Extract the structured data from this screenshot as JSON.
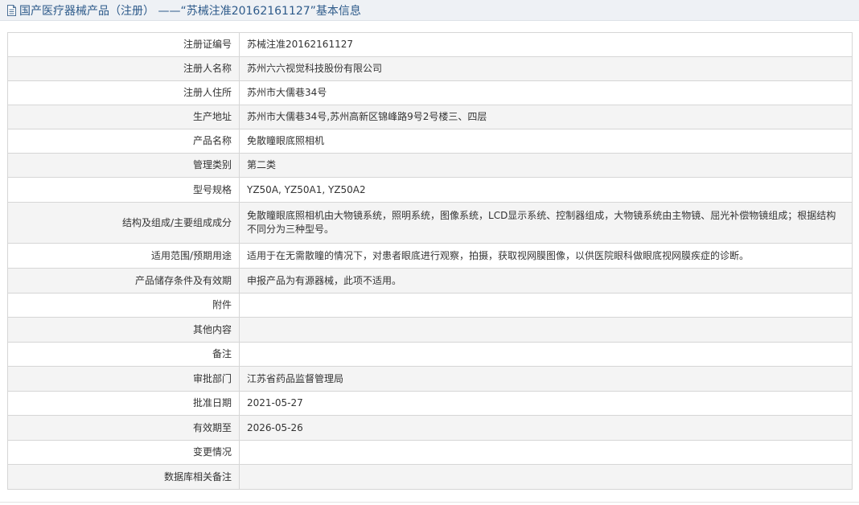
{
  "header": {
    "icon": "document-icon",
    "title": "国产医疗器械产品（注册） ——“苏械注准20162161127”基本信息"
  },
  "rows": [
    {
      "key": "reg_no",
      "label": "注册证编号",
      "value": "苏械注准20162161127"
    },
    {
      "key": "registrant_name",
      "label": "注册人名称",
      "value": "苏州六六视觉科技股份有限公司"
    },
    {
      "key": "registrant_address",
      "label": "注册人住所",
      "value": "苏州市大儒巷34号"
    },
    {
      "key": "production_address",
      "label": "生产地址",
      "value": "苏州市大儒巷34号,苏州高新区锦峰路9号2号楼三、四层"
    },
    {
      "key": "product_name",
      "label": "产品名称",
      "value": "免散瞳眼底照相机"
    },
    {
      "key": "management_category",
      "label": "管理类别",
      "value": "第二类"
    },
    {
      "key": "model_spec",
      "label": "型号规格",
      "value": "YZ50A, YZ50A1, YZ50A2"
    },
    {
      "key": "structure",
      "label": "结构及组成/主要组成成分",
      "value": "免散瞳眼底照相机由大物镜系统，照明系统，图像系统，LCD显示系统、控制器组成，大物镜系统由主物镜、屈光补偿物镜组成；根据结构不同分为三种型号。"
    },
    {
      "key": "intended_use",
      "label": "适用范围/预期用途",
      "value": "适用于在无需散瞳的情况下，对患者眼底进行观察，拍摄，获取视网膜图像，以供医院眼科做眼底视网膜疾症的诊断。"
    },
    {
      "key": "storage",
      "label": "产品储存条件及有效期",
      "value": "申报产品为有源器械，此项不适用。"
    },
    {
      "key": "attachment",
      "label": "附件",
      "value": ""
    },
    {
      "key": "other",
      "label": "其他内容",
      "value": ""
    },
    {
      "key": "remarks",
      "label": "备注",
      "value": ""
    },
    {
      "key": "approval_dept",
      "label": "审批部门",
      "value": "江苏省药品监督管理局"
    },
    {
      "key": "approval_date",
      "label": "批准日期",
      "value": "2021-05-27"
    },
    {
      "key": "valid_until",
      "label": "有效期至",
      "value": "2026-05-26"
    },
    {
      "key": "change_info",
      "label": "变更情况",
      "value": ""
    },
    {
      "key": "db_remarks",
      "label": "数据库相关备注",
      "value": ""
    }
  ]
}
